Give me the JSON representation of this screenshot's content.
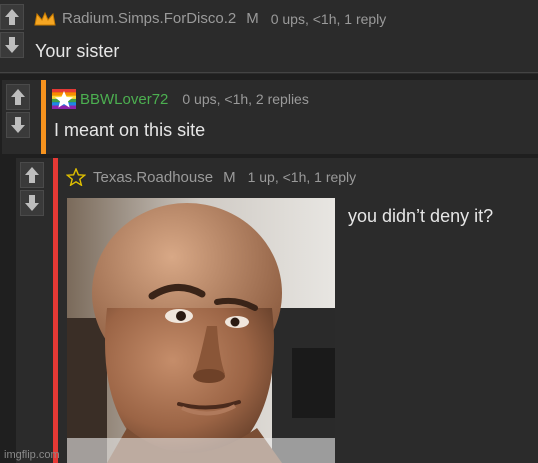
{
  "colors": {
    "bg": "#1f1f1f",
    "card": "#2b2b2b",
    "level2_bar": "#f7931e",
    "level3_bar": "#e53935",
    "green_name": "#4caf50"
  },
  "comments": [
    {
      "username": "Radium.Simps.ForDisco.2",
      "mod_badge": "M",
      "meta": "0 ups, <1h, 1 reply",
      "text": "Your sister",
      "icon": "crown-icon"
    },
    {
      "username": "BBWLover72",
      "mod_badge": "",
      "meta": "0 ups, <1h, 2 replies",
      "text": "I meant on this site",
      "icon": "rainbow-flag-star-icon"
    },
    {
      "username": "Texas.Roadhouse",
      "mod_badge": "M",
      "meta": "1 up, <1h, 1 reply",
      "text": "you didn’t deny it?",
      "icon": "star-outline-icon",
      "image": "rock-eyebrow-meme-image"
    }
  ],
  "watermark": "imgflip.com"
}
